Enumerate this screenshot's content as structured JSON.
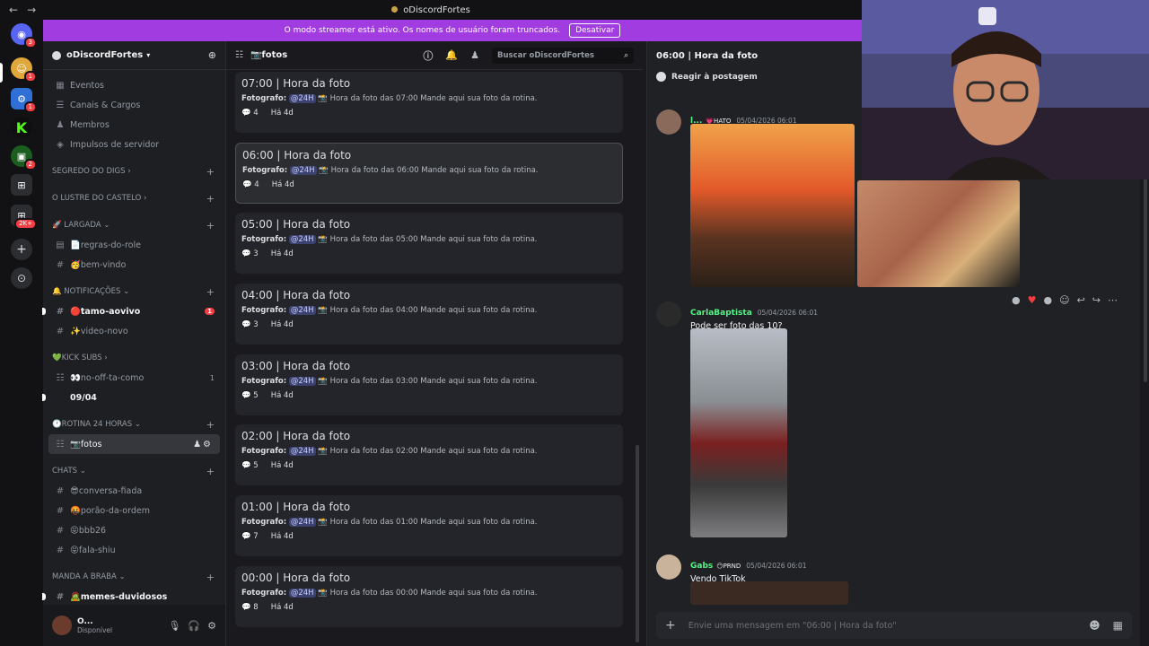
{
  "window": {
    "title": "oDiscordFortes"
  },
  "banner": {
    "text": "O modo streamer está ativo. Os nomes de usuário foram truncados.",
    "button": "Desativar"
  },
  "servers": {
    "badges": [
      "3",
      "1",
      "1",
      "2",
      "2K+"
    ]
  },
  "guild": {
    "name": "oDiscordFortes"
  },
  "sidebar": {
    "top": [
      {
        "label": "Eventos",
        "icon": "calendar-icon"
      },
      {
        "label": "Canais & Cargos",
        "icon": "channels-icon"
      },
      {
        "label": "Membros",
        "icon": "members-icon"
      },
      {
        "label": "Impulsos de servidor",
        "icon": "boost-icon"
      }
    ],
    "categories": [
      {
        "label": "SEGREDO DO DIGS"
      },
      {
        "label": "O LUSTRE DO CASTELO"
      },
      {
        "label": "🚀 LARGADA",
        "channels": [
          {
            "label": "📄regras-do-role",
            "icon": "rules-icon"
          },
          {
            "label": "🥳bem-vindo",
            "icon": "hash-icon"
          }
        ]
      },
      {
        "label": "🔔 NOTIFICAÇÕES",
        "channels": [
          {
            "label": "🔴tamo-aovivo",
            "icon": "hash-icon",
            "badge": "1"
          },
          {
            "label": "✨video-novo",
            "icon": "hash-icon"
          }
        ]
      },
      {
        "label": "💚KICK SUBS",
        "channels": [
          {
            "label": "👀no-off-ta-como",
            "icon": "forum-icon",
            "count": "1"
          },
          {
            "label": "09/04",
            "icon": "thread-icon"
          }
        ]
      },
      {
        "label": "🕐ROTINA 24 HORAS",
        "channels": [
          {
            "label": "📷fotos",
            "icon": "forum-icon"
          }
        ]
      },
      {
        "label": "CHATS",
        "channels": [
          {
            "label": "😎conversa-fiada"
          },
          {
            "label": "🤬porão-da-ordem"
          },
          {
            "label": "😝bbb26"
          },
          {
            "label": "😝fala-shiu"
          }
        ]
      },
      {
        "label": "MANDA A BRABA",
        "channels": [
          {
            "label": "🧟memes-duvidosos"
          }
        ]
      }
    ],
    "user": {
      "name": "O...",
      "status": "Disponível"
    }
  },
  "forum": {
    "title": "📷fotos",
    "search_placeholder": "Buscar oDiscordFortes",
    "posts": [
      {
        "title": "07:00 | Hora da foto",
        "author": "Fotografo:",
        "mention": "@24H",
        "body": "📸 Hora da foto das 07:00 Mande aqui sua foto da rotina.",
        "replies": "4",
        "ago": "Há 4d"
      },
      {
        "title": "06:00 | Hora da foto",
        "author": "Fotografo:",
        "mention": "@24H",
        "body": "📸 Hora da foto das 06:00 Mande aqui sua foto da rotina.",
        "replies": "4",
        "ago": "Há 4d"
      },
      {
        "title": "05:00 | Hora da foto",
        "author": "Fotografo:",
        "mention": "@24H",
        "body": "📸 Hora da foto das 05:00 Mande aqui sua foto da rotina.",
        "replies": "3",
        "ago": "Há 4d"
      },
      {
        "title": "04:00 | Hora da foto",
        "author": "Fotografo:",
        "mention": "@24H",
        "body": "📸 Hora da foto das 04:00 Mande aqui sua foto da rotina.",
        "replies": "3",
        "ago": "Há 4d"
      },
      {
        "title": "03:00 | Hora da foto",
        "author": "Fotografo:",
        "mention": "@24H",
        "body": "📸 Hora da foto das 03:00 Mande aqui sua foto da rotina.",
        "replies": "5",
        "ago": "Há 4d"
      },
      {
        "title": "02:00 | Hora da foto",
        "author": "Fotografo:",
        "mention": "@24H",
        "body": "📸 Hora da foto das 02:00 Mande aqui sua foto da rotina.",
        "replies": "5",
        "ago": "Há 4d"
      },
      {
        "title": "01:00 | Hora da foto",
        "author": "Fotografo:",
        "mention": "@24H",
        "body": "📸 Hora da foto das 01:00 Mande aqui sua foto da rotina.",
        "replies": "7",
        "ago": "Há 4d"
      },
      {
        "title": "00:00 | Hora da foto",
        "author": "Fotografo:",
        "mention": "@24H",
        "body": "📸 Hora da foto das 00:00 Mande aqui sua foto da rotina.",
        "replies": "8",
        "ago": "Há 4d"
      }
    ]
  },
  "thread": {
    "title": "06:00 | Hora da foto",
    "react_label": "Reagir à postagem",
    "messages": [
      {
        "name": "l...",
        "tag": "💗HATO",
        "time": "05/04/2026 06:01",
        "text": ""
      },
      {
        "name": "CarlaBaptista",
        "tag": "",
        "time": "05/04/2026 06:01",
        "text": "Pode ser foto das 10?"
      },
      {
        "name": "Gabs",
        "tag": "😶PRND",
        "time": "05/04/2026 06:01",
        "text": "Vendo TikTok"
      }
    ],
    "composer_placeholder": "Envie uma mensagem em \"06:00 | Hora da foto\""
  }
}
